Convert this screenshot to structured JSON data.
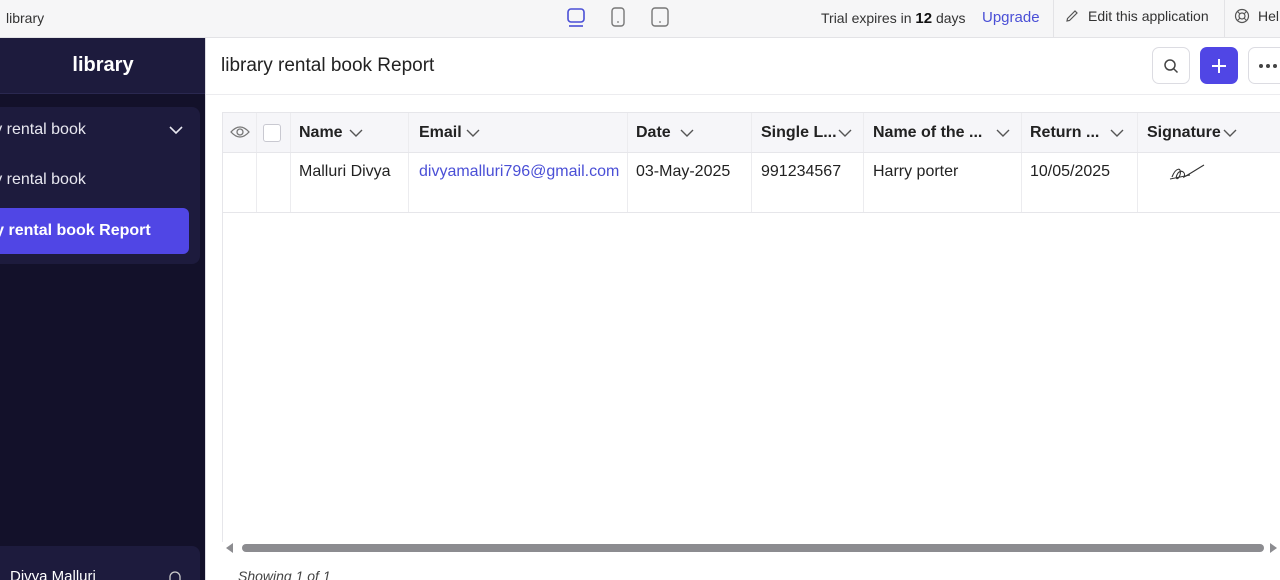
{
  "app": {
    "name": "library"
  },
  "topbar": {
    "devices": [
      "desktop-icon",
      "mobile-icon",
      "tablet-icon"
    ],
    "trial_prefix": "Trial expires in",
    "trial_days": "12",
    "trial_suffix": "days",
    "upgrade": "Upgrade",
    "edit_app": "Edit this application",
    "help": "Hel"
  },
  "sidebar": {
    "title": "library",
    "items": [
      {
        "label": "library rental book",
        "visible": "ary rental book"
      },
      {
        "label": "library rental book",
        "visible": "ary rental book"
      },
      {
        "label": "library rental book Report",
        "visible": "ary rental book Report"
      }
    ],
    "user": "Divya Malluri"
  },
  "page": {
    "title": "library rental book Report"
  },
  "table": {
    "columns": [
      "Name",
      "Email",
      "Date",
      "Single L...",
      "Name of the ...",
      "Return ...",
      "Signature"
    ],
    "rows": [
      {
        "name": "Malluri Divya",
        "email": "divyamalluri796@gmail.com",
        "date": "03-May-2025",
        "single": "991234567",
        "book": "Harry porter",
        "return": "10/05/2025",
        "signature": "signature-image"
      }
    ]
  },
  "footer": {
    "showing": "Showing 1 of 1"
  },
  "colors": {
    "accent": "#5046e5",
    "sidebar": "#13112a",
    "link": "#4a4fd6"
  }
}
